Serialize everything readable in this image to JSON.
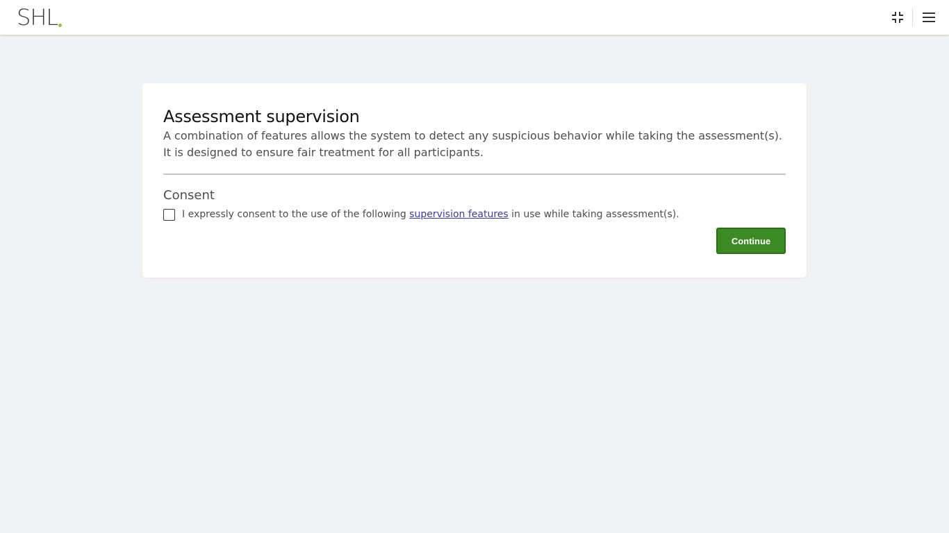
{
  "header": {
    "logo_text": "SHL",
    "logo_dot_color": "#8dc63f",
    "icons": [
      "exit-fullscreen-icon",
      "hamburger-menu-icon"
    ]
  },
  "card": {
    "title": "Assessment supervision",
    "description_line1": "A combination of features allows the system to detect any suspicious behavior while taking the assessment(s).",
    "description_line2": "It is designed to ensure fair treatment for all participants.",
    "consent_heading": "Consent",
    "consent_checked": false,
    "consent_text_before": "I expressly consent to the use of the following ",
    "consent_link_text": "supervision features",
    "consent_text_after": " in use while taking assessment(s).",
    "continue_label": "Continue"
  },
  "colors": {
    "background": "#f1f2f4",
    "primary_button": "#3c8a23",
    "link": "#3a3aa0"
  }
}
